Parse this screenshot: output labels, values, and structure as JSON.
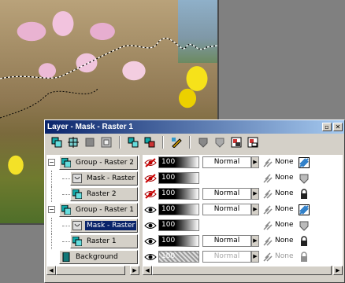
{
  "window": {
    "title": "Layer - Mask - Raster 1",
    "minimize_glyph": "✕",
    "close_glyph": "✕",
    "restore_glyph": "▫"
  },
  "toolbar": {
    "icons": [
      "new-raster-layer-icon",
      "new-vector-layer-icon",
      "new-art-media-layer-icon",
      "new-mask-layer-icon",
      "new-adjustment-layer-icon",
      "delete-layer-icon",
      "edit-selection-icon",
      "link-mask-icon",
      "unlink-mask-icon",
      "load-mask-icon",
      "save-mask-icon"
    ]
  },
  "layers": [
    {
      "name": "Group - Raster 2",
      "type": "group",
      "level": 0,
      "opacity": "100",
      "blend": "Normal",
      "none_label": "None",
      "visible": false,
      "selected": false,
      "dim": false
    },
    {
      "name": "Mask - Raster",
      "type": "mask",
      "level": 1,
      "opacity": "100",
      "blend": "",
      "none_label": "None",
      "visible": false,
      "selected": false,
      "dim": false
    },
    {
      "name": "Raster 2",
      "type": "raster",
      "level": 1,
      "opacity": "100",
      "blend": "Normal",
      "none_label": "None",
      "visible": false,
      "selected": false,
      "dim": false
    },
    {
      "name": "Group - Raster 1",
      "type": "group",
      "level": 0,
      "opacity": "100",
      "blend": "Normal",
      "none_label": "None",
      "visible": true,
      "selected": false,
      "dim": false
    },
    {
      "name": "Mask - Raster",
      "type": "mask",
      "level": 1,
      "opacity": "100",
      "blend": "",
      "none_label": "None",
      "visible": true,
      "selected": true,
      "dim": false
    },
    {
      "name": "Raster 1",
      "type": "raster",
      "level": 1,
      "opacity": "100",
      "blend": "Normal",
      "none_label": "None",
      "visible": true,
      "selected": false,
      "dim": false
    },
    {
      "name": "Background",
      "type": "background",
      "level": 0,
      "opacity": "100",
      "blend": "Normal",
      "none_label": "None",
      "visible": true,
      "selected": false,
      "dim": true
    }
  ],
  "colors": {
    "title_start": "#0a246a",
    "title_end": "#a6caf0",
    "selection": "#0a246a",
    "panel": "#d4d0c8"
  }
}
